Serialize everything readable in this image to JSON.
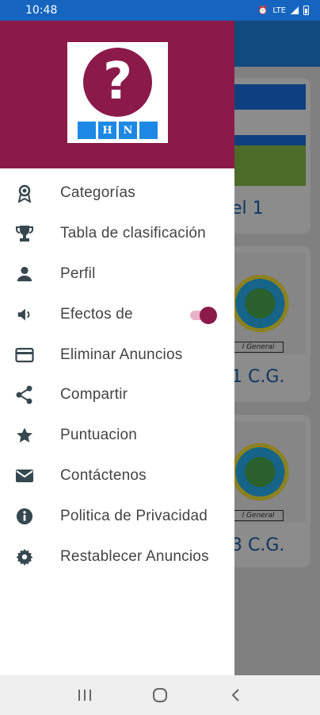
{
  "status_bar": {
    "time": "10:48",
    "network": "LTE"
  },
  "background": {
    "cards": [
      {
        "level": "el 1",
        "tag": ""
      },
      {
        "level": "1 C.G.",
        "tag": "l General"
      },
      {
        "level": "3 C.G.",
        "tag": "l General"
      }
    ]
  },
  "drawer": {
    "logo": {
      "glyph": "?",
      "letters": [
        "H",
        "N"
      ]
    },
    "items": [
      {
        "label": "Categorías",
        "icon": "award-icon"
      },
      {
        "label": "Tabla de clasificación",
        "icon": "trophy-icon"
      },
      {
        "label": "Perfil",
        "icon": "person-icon"
      },
      {
        "label": "Efectos de",
        "icon": "volume-icon",
        "toggle_on": true
      },
      {
        "label": "Eliminar Anuncios",
        "icon": "credit-card-icon"
      },
      {
        "label": "Compartir",
        "icon": "share-icon"
      },
      {
        "label": "Puntuacion",
        "icon": "star-icon"
      },
      {
        "label": "Contáctenos",
        "icon": "mail-icon"
      },
      {
        "label": "Politica de Privacidad",
        "icon": "info-icon"
      },
      {
        "label": "Restablecer Anuncios",
        "icon": "settings-icon"
      }
    ]
  },
  "colors": {
    "primary": "#8b1a4a",
    "status_bar": "#1565c0",
    "logo_blue": "#1e88e5"
  },
  "nav": {
    "buttons": [
      "recent-apps",
      "home",
      "back"
    ]
  }
}
